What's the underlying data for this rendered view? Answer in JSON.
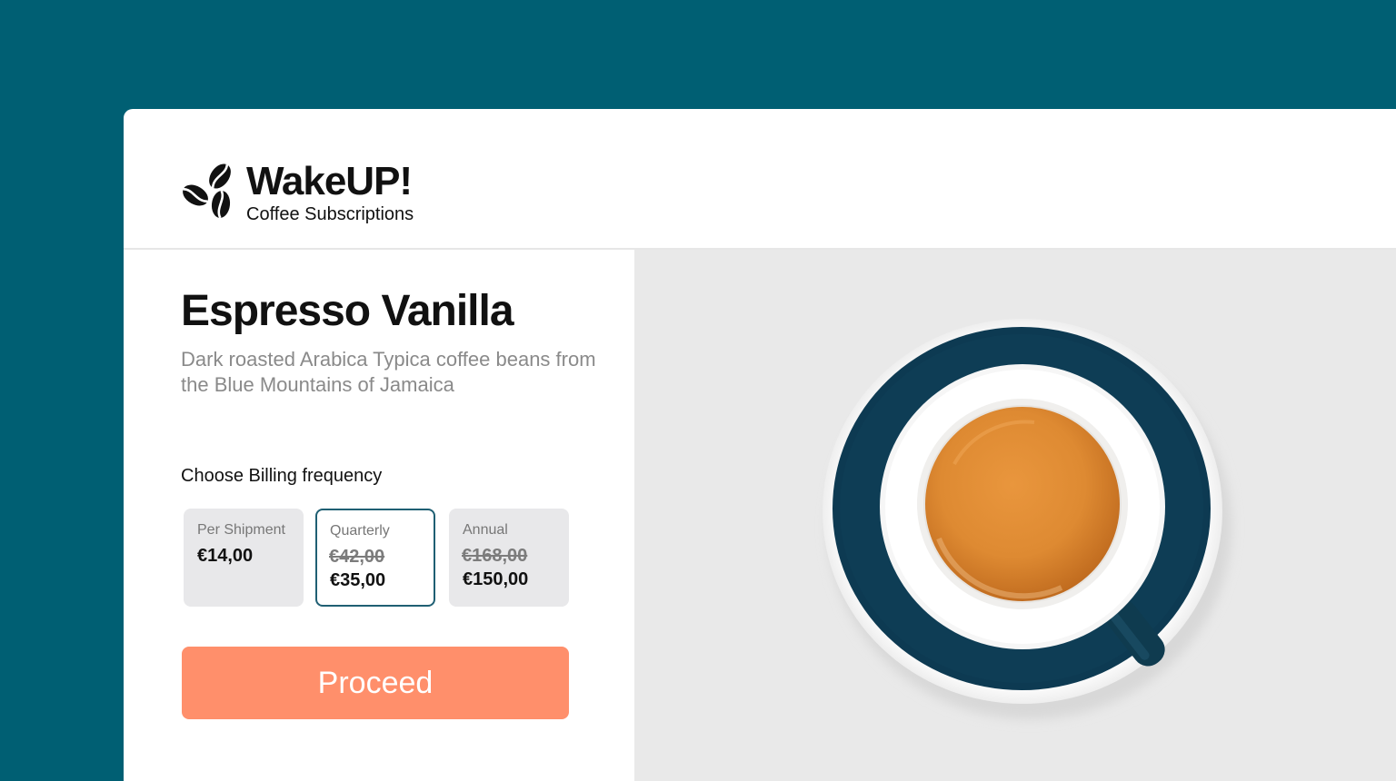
{
  "brand": {
    "name": "WakeUP!",
    "tagline": "Coffee Subscriptions",
    "logo_icon": "coffee-beans-icon"
  },
  "product": {
    "title": "Espresso Vanilla",
    "description": "Dark roasted Arabica Typica coffee beans from the Blue Mountains of Jamaica"
  },
  "billing": {
    "label": "Choose Billing frequency",
    "options": [
      {
        "name": "Per Shipment",
        "price": "€14,00",
        "selected": false
      },
      {
        "name": "Quarterly",
        "old_price": "€42,00",
        "price": "€35,00",
        "selected": true
      },
      {
        "name": "Annual",
        "old_price": "€168,00",
        "price": "€150,00",
        "selected": false
      }
    ]
  },
  "proceed_label": "Proceed",
  "colors": {
    "background": "#005f73",
    "accent": "#ff8f6b",
    "selected_border": "#1f5f73"
  }
}
